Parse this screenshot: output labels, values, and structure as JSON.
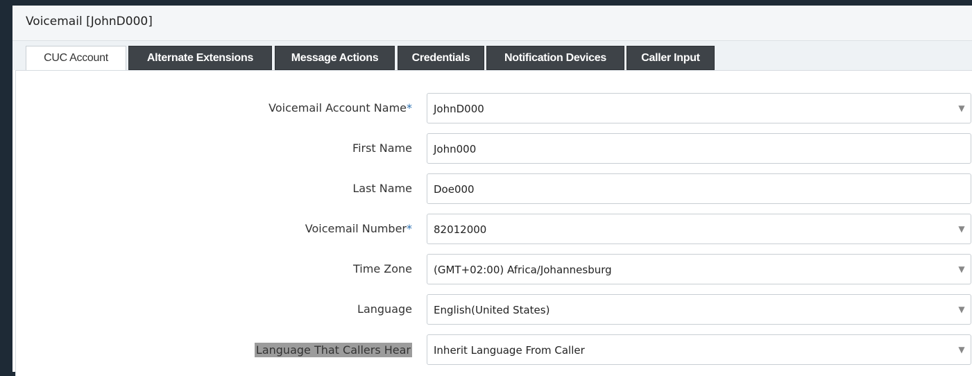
{
  "window": {
    "title": "Voicemail [JohnD000]"
  },
  "tabs": [
    {
      "label": "CUC Account",
      "active": true
    },
    {
      "label": "Alternate Extensions"
    },
    {
      "label": "Message Actions"
    },
    {
      "label": "Credentials"
    },
    {
      "label": "Notification Devices"
    },
    {
      "label": "Caller Input"
    }
  ],
  "form": {
    "account_name": {
      "label": "Voicemail Account Name",
      "required": "*",
      "value": "JohnD000"
    },
    "first_name": {
      "label": "First Name",
      "value": "John000"
    },
    "last_name": {
      "label": "Last Name",
      "value": "Doe000"
    },
    "voicemail_number": {
      "label": "Voicemail Number",
      "required": "*",
      "value": "82012000"
    },
    "time_zone": {
      "label": "Time Zone",
      "value": "(GMT+02:00) Africa/Johannesburg"
    },
    "language": {
      "label": "Language",
      "value": "English(United States)"
    },
    "callers_language": {
      "label": "Language That Callers Hear",
      "value": "Inherit Language From Caller"
    }
  },
  "icons": {
    "dropdown": "triangle-down-icon"
  },
  "colors": {
    "tab_dark": "#3e4348",
    "required_mark": "#2a6fb0",
    "highlight": "#9c9c9c"
  }
}
